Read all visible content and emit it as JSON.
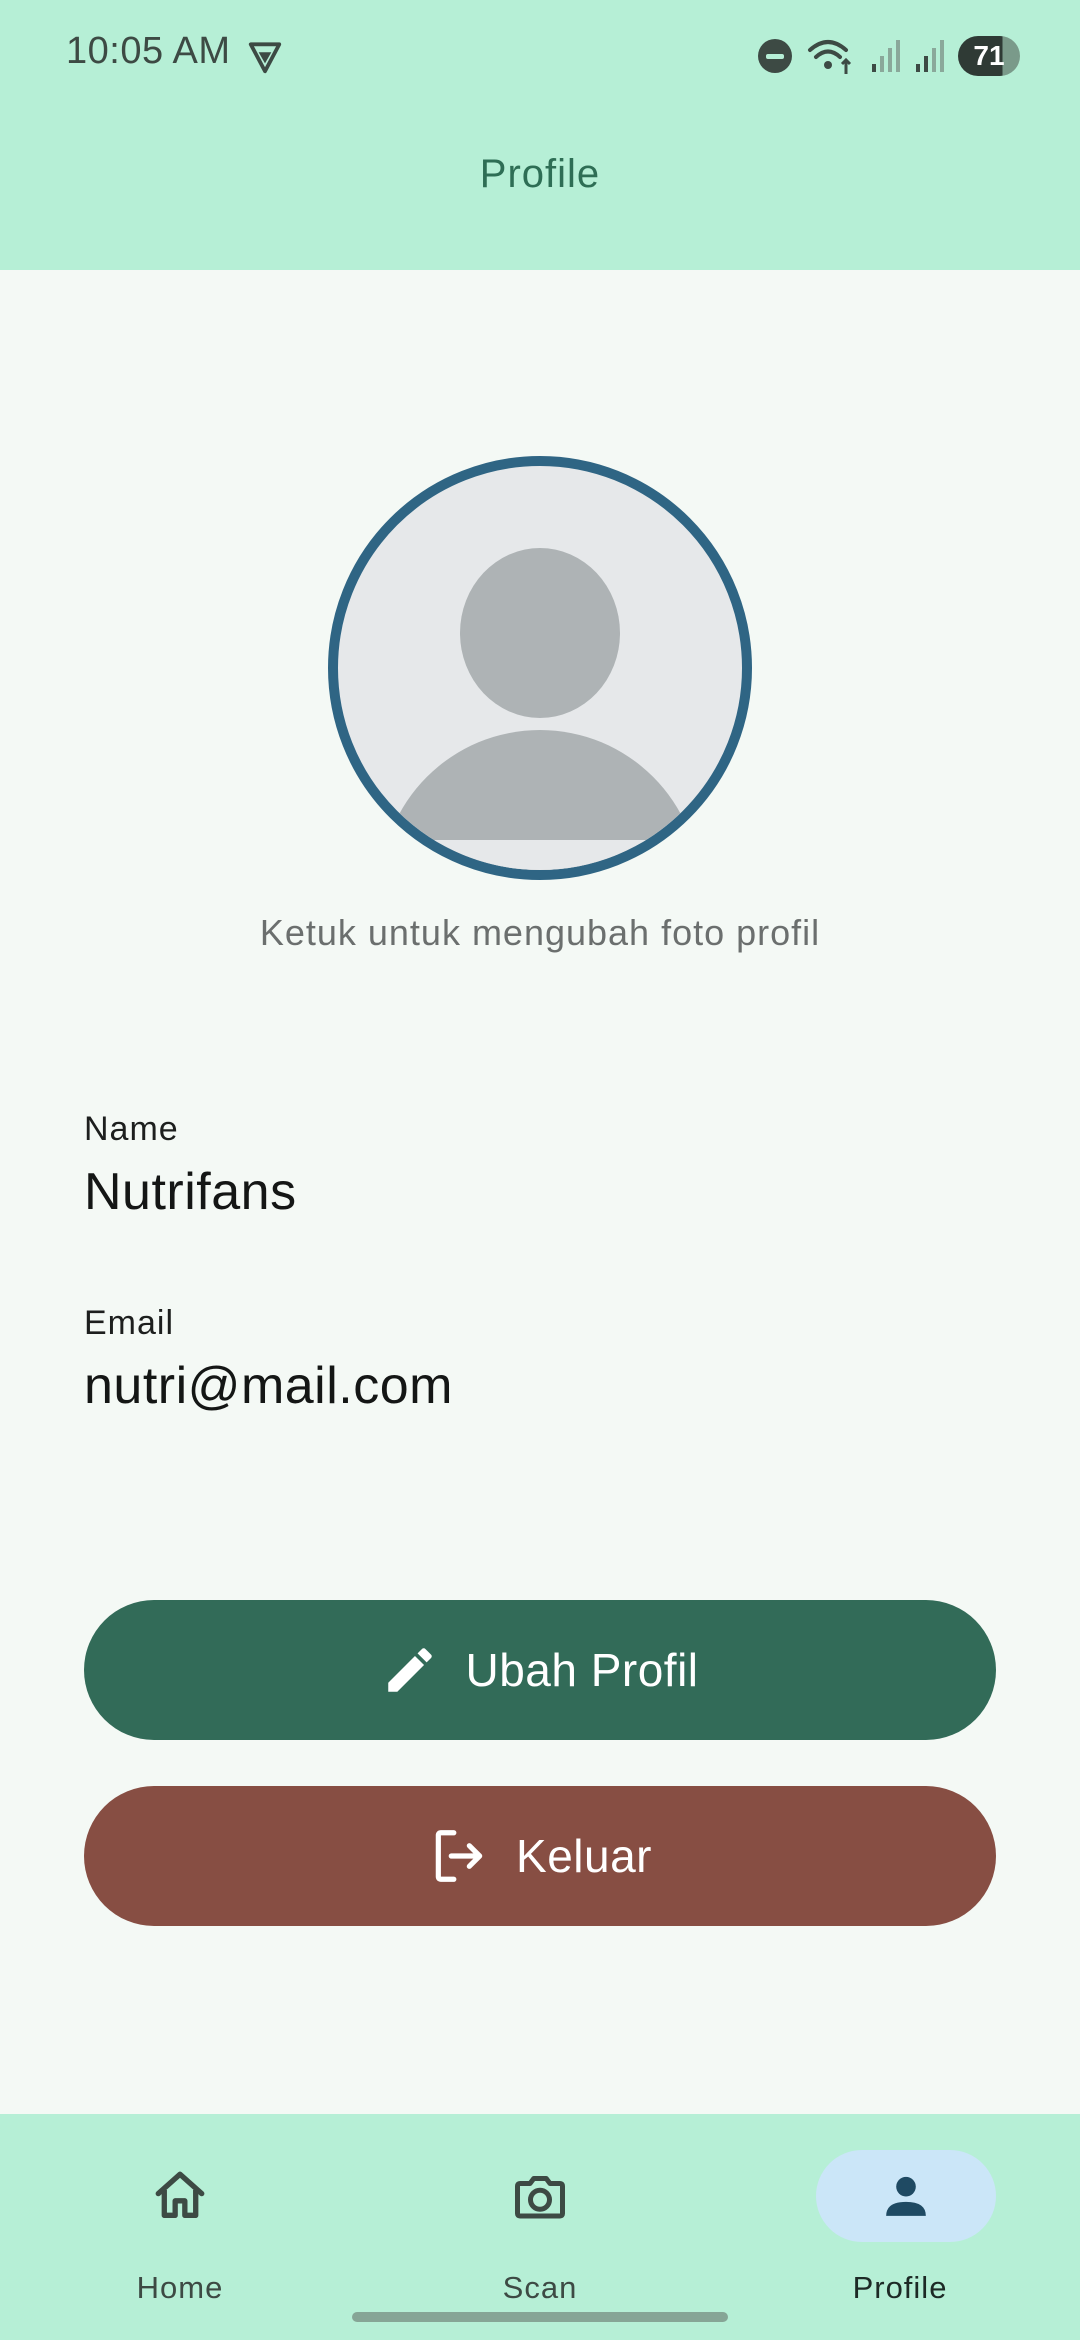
{
  "status_bar": {
    "time": "10:05 AM",
    "battery": "71",
    "icons": [
      "vpn-icon",
      "do-not-disturb-icon",
      "wifi-icon",
      "signal-icon",
      "signal-icon",
      "battery-icon"
    ]
  },
  "app_bar": {
    "title": "Profile"
  },
  "avatar": {
    "hint": "Ketuk untuk mengubah foto profil"
  },
  "profile": {
    "name_label": "Name",
    "name_value": "Nutrifans",
    "email_label": "Email",
    "email_value": "nutri@mail.com"
  },
  "actions": {
    "edit_label": "Ubah Profil",
    "logout_label": "Keluar"
  },
  "bottom_nav": {
    "items": [
      {
        "label": "Home",
        "icon": "home-icon"
      },
      {
        "label": "Scan",
        "icon": "camera-icon"
      },
      {
        "label": "Profile",
        "icon": "person-icon",
        "active": true
      }
    ]
  },
  "colors": {
    "top_bar": "#b6efd6",
    "background": "#f4f9f5",
    "edit_button": "#326b58",
    "logout_button": "#874e43",
    "avatar_ring": "#2f6584",
    "nav_active_pill": "#cbe6f8"
  }
}
